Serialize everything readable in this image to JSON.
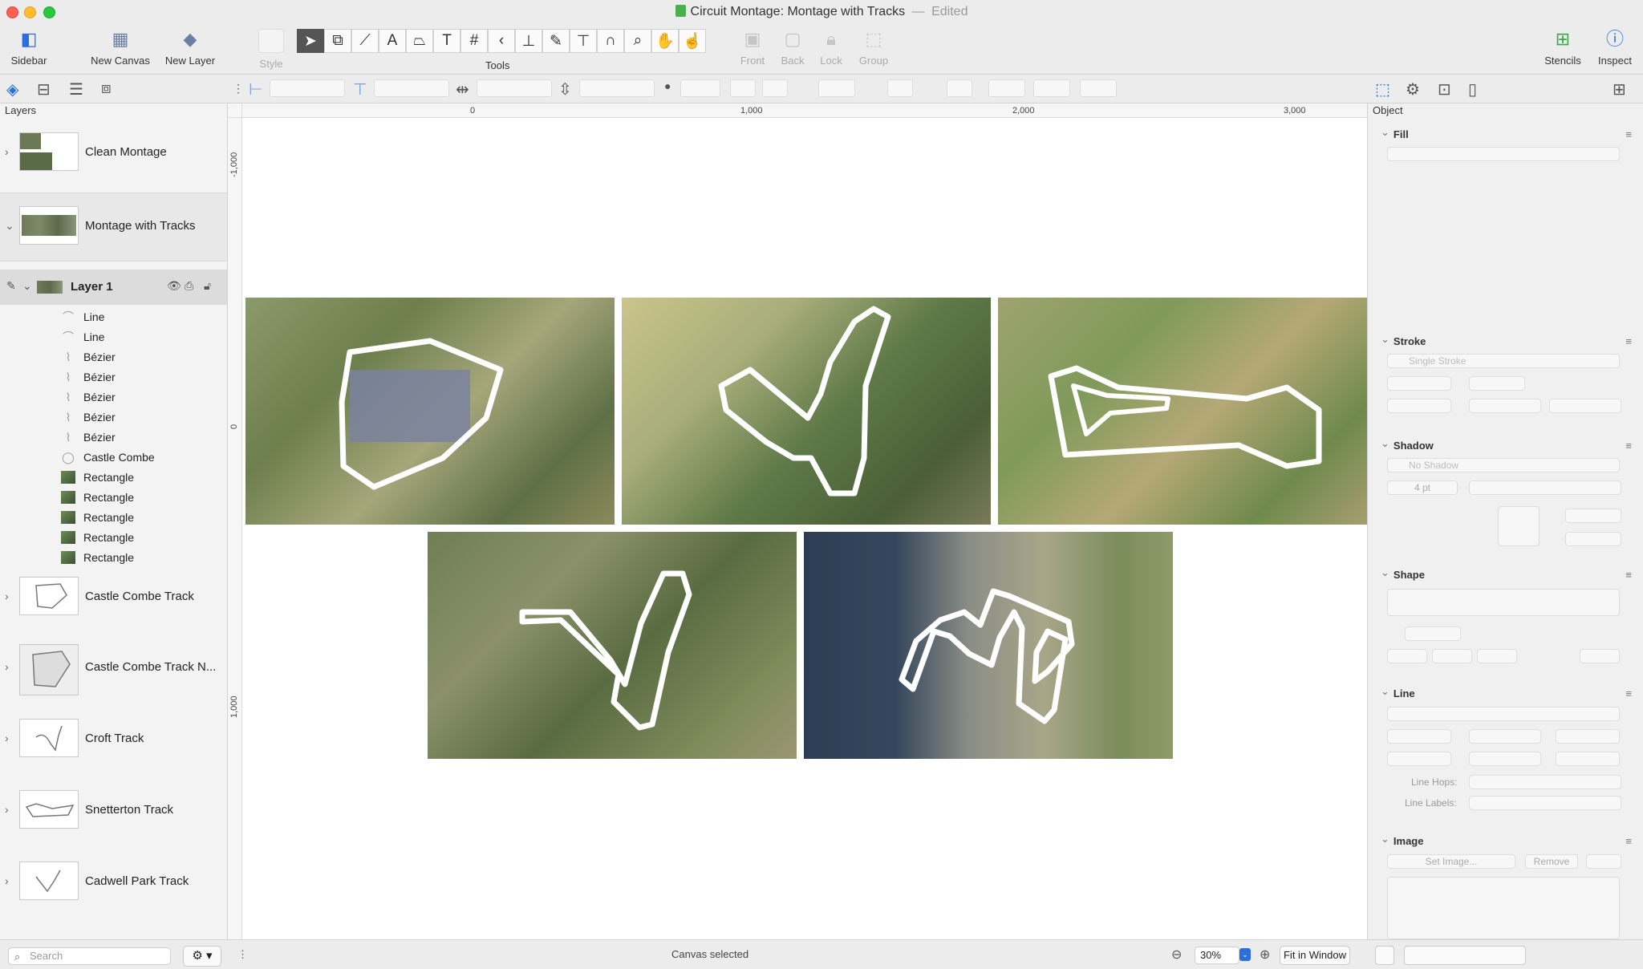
{
  "window": {
    "title": "Circuit Montage: Montage with Tracks",
    "title_sep": "—",
    "edited": "Edited"
  },
  "toolbar": {
    "sidebar": "Sidebar",
    "new_canvas": "New Canvas",
    "new_layer": "New Layer",
    "style": "Style",
    "tools": "Tools",
    "front": "Front",
    "back": "Back",
    "lock": "Lock",
    "group": "Group",
    "stencils": "Stencils",
    "inspect": "Inspect"
  },
  "sidebar": {
    "title": "Layers",
    "canvases": [
      {
        "label": "Clean Montage"
      },
      {
        "label": "Montage with Tracks"
      },
      {
        "label": "Castle Combe Track"
      },
      {
        "label": "Castle Combe Track N..."
      },
      {
        "label": "Croft Track"
      },
      {
        "label": "Snetterton Track"
      },
      {
        "label": "Cadwell Park Track"
      }
    ],
    "layer": {
      "label": "Layer 1"
    },
    "objects": [
      {
        "label": "Line",
        "icon": "line"
      },
      {
        "label": "Line",
        "icon": "line"
      },
      {
        "label": "Bézier",
        "icon": "bezier"
      },
      {
        "label": "Bézier",
        "icon": "bezier"
      },
      {
        "label": "Bézier",
        "icon": "bezier"
      },
      {
        "label": "Bézier",
        "icon": "bezier"
      },
      {
        "label": "Bézier",
        "icon": "bezier"
      },
      {
        "label": "Castle Combe",
        "icon": "shape"
      },
      {
        "label": "Rectangle",
        "icon": "image"
      },
      {
        "label": "Rectangle",
        "icon": "image"
      },
      {
        "label": "Rectangle",
        "icon": "image"
      },
      {
        "label": "Rectangle",
        "icon": "image"
      },
      {
        "label": "Rectangle",
        "icon": "image"
      }
    ],
    "search_placeholder": "Search"
  },
  "rulers": {
    "top": [
      "0",
      "1,000",
      "2,000",
      "3,000"
    ],
    "left": [
      "-1,000",
      "0",
      "1,000"
    ]
  },
  "inspector": {
    "title": "Object",
    "sections": {
      "fill": "Fill",
      "stroke": "Stroke",
      "shadow": "Shadow",
      "shape": "Shape",
      "line": "Line",
      "image": "Image"
    },
    "stroke_type": "Single Stroke",
    "shadow_type": "No Shadow",
    "shadow_size": "4 pt",
    "line_hops": "Line Hops:",
    "line_labels": "Line Labels:",
    "set_image": "Set Image...",
    "remove": "Remove"
  },
  "status": {
    "text": "Canvas selected",
    "zoom": "30%",
    "fit": "Fit in Window"
  },
  "colors": {
    "accent": "#2a6fdb",
    "track_stroke": "#ffffff"
  }
}
